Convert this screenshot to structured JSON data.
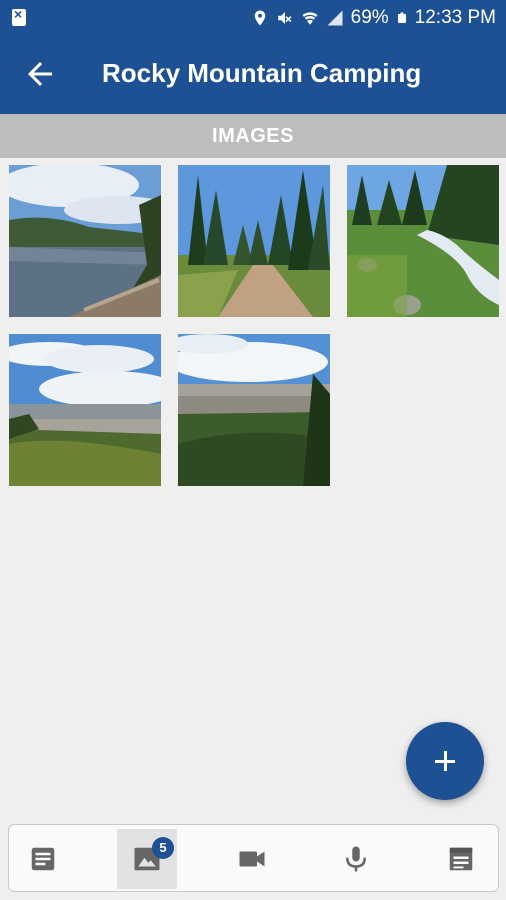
{
  "status_bar": {
    "battery": "69%",
    "time": "12:33 PM",
    "icons": [
      "location-icon",
      "mute-icon",
      "wifi-icon",
      "signal-icon",
      "battery-icon"
    ]
  },
  "app_bar": {
    "title": "Rocky Mountain Camping",
    "back_icon": "arrow-left-icon"
  },
  "section": {
    "header": "IMAGES"
  },
  "images": [
    {
      "scene": "lake"
    },
    {
      "scene": "forest-road"
    },
    {
      "scene": "mountain-stream"
    },
    {
      "scene": "valley-view"
    },
    {
      "scene": "overlook"
    }
  ],
  "fab": {
    "icon": "plus-icon"
  },
  "bottom_nav": {
    "items": [
      {
        "icon": "notes-icon"
      },
      {
        "icon": "image-icon",
        "badge": "5"
      },
      {
        "icon": "video-icon"
      },
      {
        "icon": "microphone-icon"
      },
      {
        "icon": "list-document-icon"
      }
    ]
  },
  "colors": {
    "primary": "#1e5193",
    "header_gray": "#bdbdbd",
    "background": "#efefef"
  }
}
